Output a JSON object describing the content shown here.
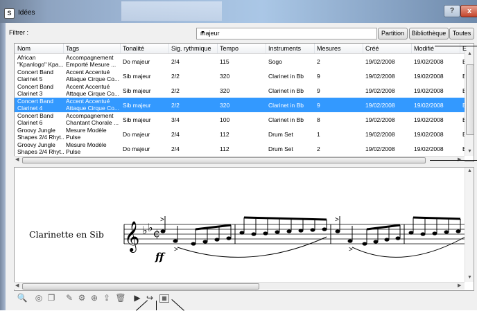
{
  "window": {
    "title": "Idées",
    "help_label": "?",
    "close_label": "x",
    "icon_label": "S"
  },
  "filter": {
    "label": "Filtrer :",
    "value": "majeur",
    "buttons": [
      "Partition",
      "Bibliothèque",
      "Toutes"
    ]
  },
  "table": {
    "headers": [
      "Nom",
      "Tags",
      "Tonalité",
      "Sig. rythmique",
      "Tempo",
      "Instruments",
      "Mesures",
      "Créé",
      "Modifié",
      "E"
    ],
    "rows": [
      {
        "nom": [
          "African",
          "\"Kpanlogo\" Kpa..."
        ],
        "tags": [
          "Accompagnement",
          "Emporté Mesure ..."
        ],
        "tonalite": "Do majeur",
        "sig": "2/4",
        "tempo": "115",
        "instruments": "Sogo",
        "mesures": "2",
        "cree": "19/02/2008",
        "modifie": "19/02/2008",
        "e": "E",
        "selected": false
      },
      {
        "nom": [
          "Concert Band",
          "Clarinet 5"
        ],
        "tags": [
          "Accent Accentué",
          "Attaque Cirque Co..."
        ],
        "tonalite": "Sib majeur",
        "sig": "2/2",
        "tempo": "320",
        "instruments": "Clarinet in Bb",
        "mesures": "9",
        "cree": "19/02/2008",
        "modifie": "19/02/2008",
        "e": "E",
        "selected": false
      },
      {
        "nom": [
          "Concert Band",
          "Clarinet 3"
        ],
        "tags": [
          "Accent Accentué",
          "Attaque Cirque Co..."
        ],
        "tonalite": "Sib majeur",
        "sig": "2/2",
        "tempo": "320",
        "instruments": "Clarinet in Bb",
        "mesures": "9",
        "cree": "19/02/2008",
        "modifie": "19/02/2008",
        "e": "E",
        "selected": false
      },
      {
        "nom": [
          "Concert Band",
          "Clarinet 4"
        ],
        "tags": [
          "Accent Accentué",
          "Attaque Cirque Co..."
        ],
        "tonalite": "Sib majeur",
        "sig": "2/2",
        "tempo": "320",
        "instruments": "Clarinet in Bb",
        "mesures": "9",
        "cree": "19/02/2008",
        "modifie": "19/02/2008",
        "e": "E",
        "selected": true
      },
      {
        "nom": [
          "Concert Band",
          "Clarinet 6"
        ],
        "tags": [
          "Accompagnement",
          "Chantant Chorale ..."
        ],
        "tonalite": "Sib majeur",
        "sig": "3/4",
        "tempo": "100",
        "instruments": "Clarinet in Bb",
        "mesures": "8",
        "cree": "19/02/2008",
        "modifie": "19/02/2008",
        "e": "E",
        "selected": false
      },
      {
        "nom": [
          "Groovy Jungle",
          "Shapes 2/4 Rhyt..."
        ],
        "tags": [
          "Mesure Modèle",
          "Pulse"
        ],
        "tonalite": "Do majeur",
        "sig": "2/4",
        "tempo": "112",
        "instruments": "Drum Set",
        "mesures": "1",
        "cree": "19/02/2008",
        "modifie": "19/02/2008",
        "e": "E",
        "selected": false
      },
      {
        "nom": [
          "Groovy Jungle",
          "Shapes 2/4 Rhyt..."
        ],
        "tags": [
          "Mesure Modèle",
          "Pulse"
        ],
        "tonalite": "Do majeur",
        "sig": "2/4",
        "tempo": "112",
        "instruments": "Drum Set",
        "mesures": "2",
        "cree": "19/02/2008",
        "modifie": "19/02/2008",
        "e": "E",
        "selected": false
      }
    ]
  },
  "score": {
    "instrument_label": "Clarinette en Sib",
    "dynamic": "ff"
  },
  "toolbar": {
    "icons": [
      "zoom-icon",
      "import-icon",
      "copy-icon",
      "edit-icon",
      "settings-icon",
      "new-idea-icon",
      "export-icon",
      "delete-icon",
      "play-icon",
      "paste-icon",
      "capture-icon"
    ]
  },
  "colors": {
    "selection": "#3399ff",
    "title_gradient_mid": "#9eb7d6"
  }
}
